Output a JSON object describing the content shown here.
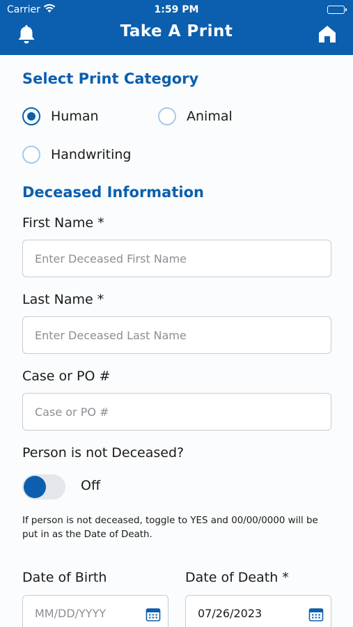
{
  "status_bar": {
    "carrier": "Carrier",
    "time": "1:59 PM"
  },
  "header": {
    "title": "Take A Print"
  },
  "category": {
    "title": "Select Print Category",
    "options": [
      {
        "label": "Human",
        "selected": true
      },
      {
        "label": "Animal",
        "selected": false
      },
      {
        "label": "Handwriting",
        "selected": false
      }
    ]
  },
  "deceased": {
    "title": "Deceased Information",
    "first_name": {
      "label": "First Name *",
      "placeholder": "Enter Deceased First Name",
      "value": ""
    },
    "last_name": {
      "label": "Last Name *",
      "placeholder": "Enter Deceased Last Name",
      "value": ""
    },
    "case_po": {
      "label": "Case or PO #",
      "placeholder": "Case or PO #",
      "value": ""
    },
    "not_deceased": {
      "label": "Person is not Deceased?",
      "toggle_state": "Off",
      "helper": "If person is not deceased, toggle to YES and 00/00/0000 will be put in as the Date of Death."
    },
    "dob": {
      "label": "Date of Birth",
      "placeholder": "MM/DD/YYYY"
    },
    "dod": {
      "label": "Date of Death *",
      "value": "07/26/2023"
    }
  },
  "colors": {
    "primary": "#0b5fae",
    "radio_unchecked": "#a9c9e6",
    "input_border": "#c8ccd1"
  },
  "icons": {
    "left_nav": "bell-icon",
    "right_nav": "home-icon",
    "date_picker": "calendar-icon"
  }
}
